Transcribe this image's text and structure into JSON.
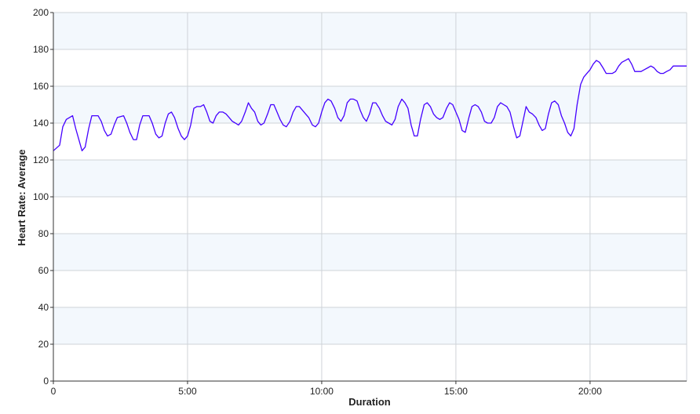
{
  "chart_data": {
    "type": "line",
    "title": "",
    "xlabel": "Duration",
    "ylabel": "Heart Rate: Average",
    "xlim": [
      0,
      1416
    ],
    "ylim": [
      0,
      200
    ],
    "x_unit": "seconds",
    "x_ticks": [
      {
        "value": 0,
        "label": "0"
      },
      {
        "value": 300,
        "label": "5:00"
      },
      {
        "value": 600,
        "label": "10:00"
      },
      {
        "value": 900,
        "label": "15:00"
      },
      {
        "value": 1200,
        "label": "20:00"
      }
    ],
    "y_ticks": [
      0,
      20,
      40,
      60,
      80,
      100,
      120,
      140,
      160,
      180,
      200
    ],
    "grid": true,
    "banded_background": true,
    "colors": {
      "line": "#4400ff",
      "band": "#f3f8fd",
      "grid": "#cfd3d8",
      "axis": "#333333"
    },
    "series": [
      {
        "values": [
          [
            0,
            125
          ],
          [
            14,
            128
          ],
          [
            21,
            138
          ],
          [
            29,
            142
          ],
          [
            43,
            144
          ],
          [
            50,
            137
          ],
          [
            57,
            131
          ],
          [
            64,
            125
          ],
          [
            71,
            127
          ],
          [
            79,
            137
          ],
          [
            86,
            144
          ],
          [
            100,
            144
          ],
          [
            107,
            141
          ],
          [
            114,
            136
          ],
          [
            121,
            133
          ],
          [
            129,
            134
          ],
          [
            136,
            139
          ],
          [
            143,
            143
          ],
          [
            157,
            144
          ],
          [
            164,
            140
          ],
          [
            171,
            135
          ],
          [
            179,
            131
          ],
          [
            186,
            131
          ],
          [
            193,
            139
          ],
          [
            200,
            144
          ],
          [
            214,
            144
          ],
          [
            221,
            140
          ],
          [
            229,
            134
          ],
          [
            236,
            132
          ],
          [
            243,
            133
          ],
          [
            250,
            140
          ],
          [
            257,
            145
          ],
          [
            264,
            146
          ],
          [
            271,
            143
          ],
          [
            279,
            137
          ],
          [
            286,
            133
          ],
          [
            293,
            131
          ],
          [
            300,
            133
          ],
          [
            307,
            139
          ],
          [
            314,
            148
          ],
          [
            321,
            149
          ],
          [
            329,
            149
          ],
          [
            336,
            150
          ],
          [
            343,
            146
          ],
          [
            350,
            141
          ],
          [
            357,
            140
          ],
          [
            364,
            144
          ],
          [
            371,
            146
          ],
          [
            379,
            146
          ],
          [
            386,
            145
          ],
          [
            393,
            143
          ],
          [
            400,
            141
          ],
          [
            407,
            140
          ],
          [
            414,
            139
          ],
          [
            421,
            141
          ],
          [
            429,
            146
          ],
          [
            436,
            151
          ],
          [
            443,
            148
          ],
          [
            450,
            146
          ],
          [
            457,
            141
          ],
          [
            464,
            139
          ],
          [
            471,
            140
          ],
          [
            479,
            145
          ],
          [
            486,
            150
          ],
          [
            493,
            150
          ],
          [
            500,
            146
          ],
          [
            507,
            142
          ],
          [
            514,
            139
          ],
          [
            521,
            138
          ],
          [
            529,
            141
          ],
          [
            536,
            146
          ],
          [
            543,
            149
          ],
          [
            550,
            149
          ],
          [
            557,
            147
          ],
          [
            564,
            145
          ],
          [
            571,
            143
          ],
          [
            579,
            139
          ],
          [
            586,
            138
          ],
          [
            593,
            140
          ],
          [
            600,
            146
          ],
          [
            607,
            151
          ],
          [
            614,
            153
          ],
          [
            621,
            152
          ],
          [
            629,
            148
          ],
          [
            636,
            143
          ],
          [
            643,
            141
          ],
          [
            650,
            144
          ],
          [
            657,
            151
          ],
          [
            664,
            153
          ],
          [
            671,
            153
          ],
          [
            679,
            152
          ],
          [
            686,
            147
          ],
          [
            693,
            143
          ],
          [
            700,
            141
          ],
          [
            707,
            145
          ],
          [
            714,
            151
          ],
          [
            721,
            151
          ],
          [
            729,
            148
          ],
          [
            736,
            144
          ],
          [
            743,
            141
          ],
          [
            750,
            140
          ],
          [
            757,
            139
          ],
          [
            764,
            142
          ],
          [
            771,
            149
          ],
          [
            779,
            153
          ],
          [
            786,
            151
          ],
          [
            793,
            148
          ],
          [
            800,
            139
          ],
          [
            807,
            133
          ],
          [
            814,
            133
          ],
          [
            821,
            142
          ],
          [
            829,
            150
          ],
          [
            836,
            151
          ],
          [
            843,
            149
          ],
          [
            850,
            145
          ],
          [
            857,
            143
          ],
          [
            864,
            142
          ],
          [
            871,
            143
          ],
          [
            879,
            148
          ],
          [
            886,
            151
          ],
          [
            893,
            150
          ],
          [
            900,
            146
          ],
          [
            907,
            142
          ],
          [
            914,
            136
          ],
          [
            921,
            135
          ],
          [
            929,
            143
          ],
          [
            936,
            149
          ],
          [
            943,
            150
          ],
          [
            950,
            149
          ],
          [
            957,
            146
          ],
          [
            964,
            141
          ],
          [
            971,
            140
          ],
          [
            979,
            140
          ],
          [
            986,
            143
          ],
          [
            993,
            149
          ],
          [
            1000,
            151
          ],
          [
            1007,
            150
          ],
          [
            1014,
            149
          ],
          [
            1021,
            146
          ],
          [
            1029,
            138
          ],
          [
            1036,
            132
          ],
          [
            1043,
            133
          ],
          [
            1050,
            141
          ],
          [
            1057,
            149
          ],
          [
            1064,
            146
          ],
          [
            1071,
            145
          ],
          [
            1079,
            143
          ],
          [
            1086,
            139
          ],
          [
            1093,
            136
          ],
          [
            1100,
            137
          ],
          [
            1107,
            145
          ],
          [
            1114,
            151
          ],
          [
            1121,
            152
          ],
          [
            1129,
            150
          ],
          [
            1136,
            144
          ],
          [
            1143,
            140
          ],
          [
            1150,
            135
          ],
          [
            1157,
            133
          ],
          [
            1164,
            137
          ],
          [
            1171,
            150
          ],
          [
            1179,
            161
          ],
          [
            1186,
            165
          ],
          [
            1193,
            167
          ],
          [
            1200,
            169
          ],
          [
            1207,
            172
          ],
          [
            1214,
            174
          ],
          [
            1221,
            173
          ],
          [
            1229,
            170
          ],
          [
            1236,
            167
          ],
          [
            1243,
            167
          ],
          [
            1250,
            167
          ],
          [
            1257,
            168
          ],
          [
            1264,
            171
          ],
          [
            1271,
            173
          ],
          [
            1279,
            174
          ],
          [
            1286,
            175
          ],
          [
            1293,
            172
          ],
          [
            1300,
            168
          ],
          [
            1307,
            168
          ],
          [
            1314,
            168
          ],
          [
            1321,
            169
          ],
          [
            1329,
            170
          ],
          [
            1336,
            171
          ],
          [
            1343,
            170
          ],
          [
            1350,
            168
          ],
          [
            1357,
            167
          ],
          [
            1364,
            167
          ],
          [
            1371,
            168
          ],
          [
            1379,
            169
          ],
          [
            1386,
            171
          ],
          [
            1400,
            171
          ],
          [
            1416,
            171
          ]
        ]
      }
    ]
  }
}
